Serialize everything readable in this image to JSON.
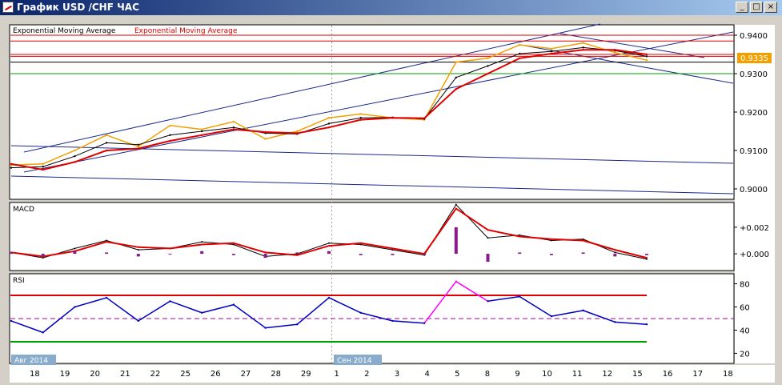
{
  "window": {
    "title": "График USD /CHF ЧАС",
    "buttons": {
      "minimize": "_",
      "maximize": "□",
      "close": "×"
    }
  },
  "colors": {
    "price": "#f0a000",
    "ema_fast": "#000000",
    "ema_slow": "#e00000",
    "channel": "#1a2a8c",
    "macd_hist": "#8a1a8a",
    "rsi": "#0000c0",
    "rsi_overbought": "#ff00ff",
    "green_line": "#00a000",
    "price_tag_bg": "#f0a000"
  },
  "chart_data": [
    {
      "type": "line",
      "panel": "price",
      "legend": [
        "Exponential Moving Average",
        "Exponential Moving Average"
      ],
      "current_price_label": "0.9335",
      "y_ticks": [
        "0.9400",
        "0.9300",
        "0.9200",
        "0.9100",
        "0.9000"
      ],
      "ylim": [
        0.8975,
        0.9425
      ],
      "x_dates": [
        "18",
        "19",
        "20",
        "21",
        "22",
        "25",
        "26",
        "27",
        "28",
        "29",
        "1",
        "2",
        "3",
        "4",
        "5",
        "8",
        "9",
        "10",
        "11",
        "12",
        "15",
        "16",
        "17",
        "18"
      ],
      "month_labels": [
        "Авг 2014",
        "Сен 2014"
      ],
      "series": [
        {
          "name": "",
          "role": "price",
          "values": [
            0.9062,
            0.9065,
            0.91,
            0.914,
            0.911,
            0.9165,
            0.9155,
            0.9175,
            0.913,
            0.915,
            0.9185,
            0.9195,
            0.9185,
            0.918,
            0.933,
            0.934,
            0.9375,
            0.9365,
            0.938,
            0.9355,
            0.9335
          ]
        },
        {
          "name": "Exponential Moving Average",
          "role": "ema_fast",
          "values": [
            0.9055,
            0.9058,
            0.9085,
            0.912,
            0.9115,
            0.914,
            0.915,
            0.916,
            0.9145,
            0.9143,
            0.917,
            0.9185,
            0.9186,
            0.9182,
            0.929,
            0.932,
            0.9352,
            0.9358,
            0.9368,
            0.936,
            0.9345
          ]
        },
        {
          "name": "Exponential Moving Average",
          "role": "ema_slow",
          "values": [
            0.9065,
            0.905,
            0.907,
            0.91,
            0.9105,
            0.9125,
            0.914,
            0.9155,
            0.9148,
            0.9145,
            0.916,
            0.918,
            0.9185,
            0.9184,
            0.926,
            0.93,
            0.934,
            0.9352,
            0.9362,
            0.9362,
            0.935
          ]
        }
      ],
      "horizontal_levels": [
        0.94,
        0.9385,
        0.935,
        0.9345,
        0.933
      ],
      "green_level": 0.93
    },
    {
      "type": "line",
      "panel": "macd",
      "label": "MACD",
      "y_ticks": [
        "+0.002",
        "+0.000"
      ],
      "ylim": [
        -0.0012,
        0.0038
      ],
      "series": [
        {
          "name": "",
          "role": "macd",
          "values": [
            0.0001,
            -0.0003,
            0.0004,
            0.001,
            0.0003,
            0.0004,
            0.0009,
            0.0007,
            -0.0002,
            0.0,
            0.0008,
            0.0007,
            0.0003,
            -0.0001,
            0.0037,
            0.0012,
            0.0014,
            0.001,
            0.0011,
            0.0001,
            -0.0004
          ]
        },
        {
          "name": "",
          "role": "signal",
          "values": [
            0.0001,
            -0.0002,
            0.0002,
            0.0009,
            0.0005,
            0.0004,
            0.0007,
            0.0008,
            0.0001,
            -0.0001,
            0.0006,
            0.0008,
            0.0004,
            0.0,
            0.0034,
            0.0018,
            0.0013,
            0.0011,
            0.001,
            0.0003,
            -0.0003
          ]
        },
        {
          "name": "",
          "role": "hist",
          "values": [
            0.0001,
            -0.0002,
            0.0002,
            0.0001,
            -0.0002,
            0.0,
            0.0002,
            -0.0001,
            -0.0003,
            0.0001,
            0.0002,
            -0.0001,
            -0.0001,
            -0.0001,
            0.002,
            -0.0006,
            0.0001,
            -0.0001,
            0.0001,
            -0.0002,
            -0.0001
          ]
        }
      ]
    },
    {
      "type": "line",
      "panel": "rsi",
      "label": "RSI",
      "y_ticks": [
        "80",
        "60",
        "40",
        "20"
      ],
      "ylim": [
        12,
        88
      ],
      "levels": {
        "upper": 70,
        "middle": 50,
        "lower": 30
      },
      "series": [
        {
          "name": "",
          "role": "rsi",
          "values": [
            48,
            38,
            60,
            68,
            48,
            65,
            55,
            62,
            42,
            45,
            68,
            55,
            48,
            46,
            82,
            65,
            69,
            52,
            57,
            47,
            45
          ]
        }
      ]
    }
  ]
}
